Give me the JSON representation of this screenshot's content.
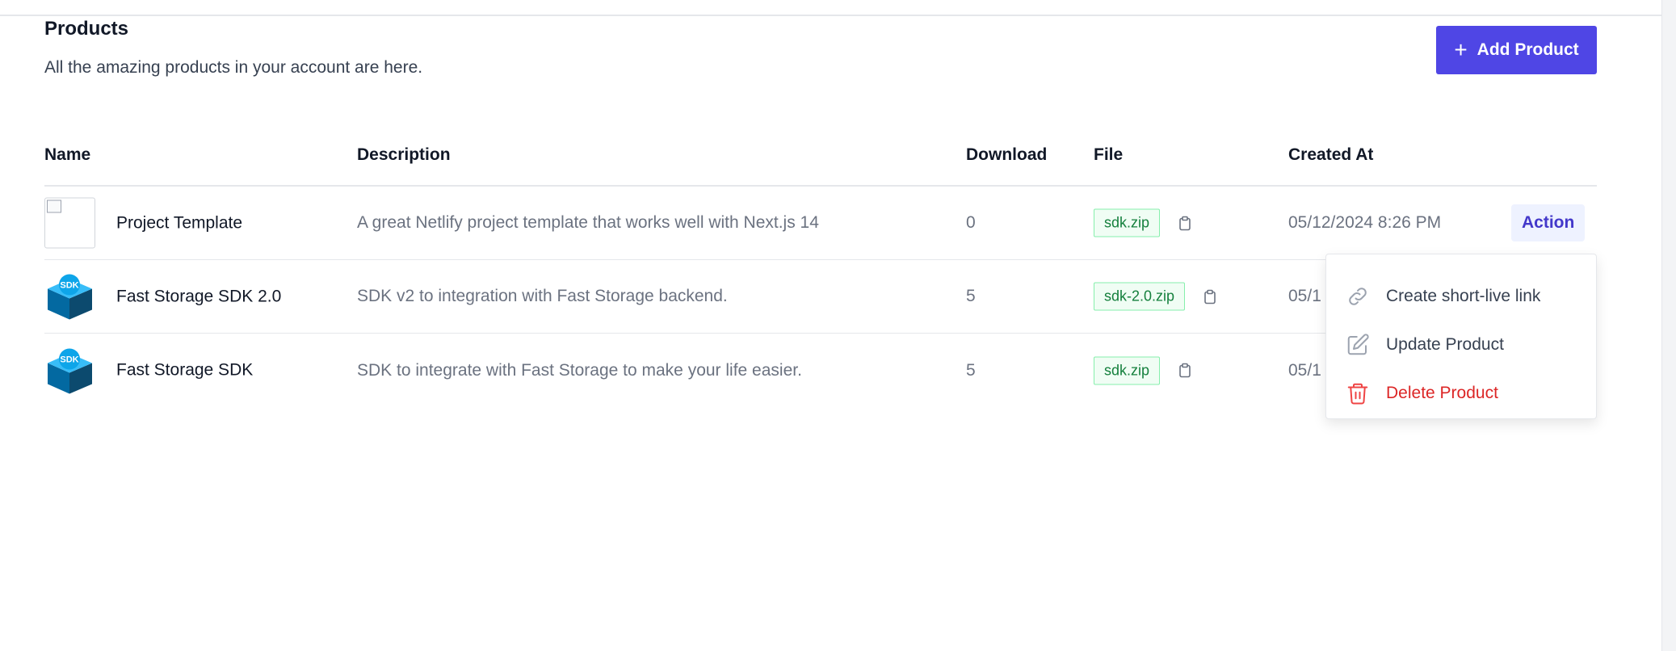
{
  "header": {
    "title": "Products",
    "subtitle": "All the amazing products in your account are here.",
    "add_button_label": "Add Product"
  },
  "table": {
    "columns": [
      "Name",
      "Description",
      "Download",
      "File",
      "Created At"
    ],
    "rows": [
      {
        "name": "Project Template",
        "description": "A great Netlify project template that works well with Next.js 14",
        "download": "0",
        "file": "sdk.zip",
        "created_at": "05/12/2024 8:26 PM",
        "thumbnail": "broken-image-icon"
      },
      {
        "name": "Fast Storage SDK 2.0",
        "description": "SDK v2 to integration with Fast Storage backend.",
        "download": "5",
        "file": "sdk-2.0.zip",
        "created_at": "05/1",
        "thumbnail": "sdk-box-icon"
      },
      {
        "name": "Fast Storage SDK",
        "description": "SDK to integrate with Fast Storage to make your life easier.",
        "download": "5",
        "file": "sdk.zip",
        "created_at": "05/1",
        "thumbnail": "sdk-box-icon"
      }
    ],
    "action_label": "Action"
  },
  "action_menu": {
    "items": [
      {
        "label": "Create short-live link",
        "icon": "link-icon"
      },
      {
        "label": "Update Product",
        "icon": "pencil-icon"
      },
      {
        "label": "Delete Product",
        "icon": "trash-icon"
      }
    ]
  },
  "icons": {
    "sdk_box_label": "SDK"
  },
  "colors": {
    "primary": "#4f46e5",
    "action_bg": "#eef2ff",
    "file_badge_bg": "#f0fdf4",
    "file_badge_text": "#15803d",
    "danger": "#dc2626"
  }
}
